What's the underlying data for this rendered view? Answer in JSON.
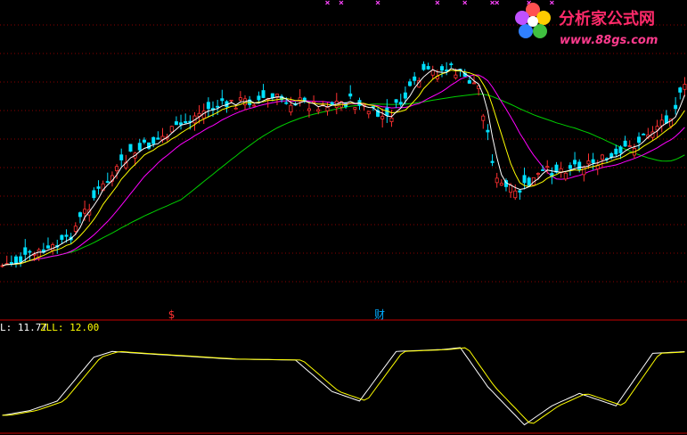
{
  "chart_data": [
    {
      "type": "candlestick",
      "title": "",
      "xlabel": "",
      "ylabel": "",
      "ylim": [
        0,
        100
      ],
      "grid": true,
      "bar_count": 150,
      "up_color": "#ff3030",
      "down_color": "#00e0ff",
      "marker_labels": [
        {
          "text": "$",
          "bar": 37,
          "color": "#ff3030"
        },
        {
          "text": "财",
          "bar": 82,
          "color": "#00aaff"
        }
      ],
      "ma_colors": {
        "fast": "#ffffff",
        "mid": "#ffff00",
        "slow": "#ff00ff",
        "long": "#00d000"
      }
    },
    {
      "type": "line",
      "title": "",
      "series": [
        {
          "name": "L",
          "label": ": 11.77",
          "color": "#ffffff"
        },
        {
          "name": "ZLL",
          "label": ": 12.00",
          "color": "#ffff00"
        }
      ],
      "ylim": [
        0,
        100
      ]
    }
  ],
  "watermark": {
    "brand": "分析家公式网",
    "url": "www.88gs.com"
  },
  "colors": {
    "background": "#000000",
    "grid": "#8b0000",
    "divider": "#c80000",
    "x_marker": "#ff44ff"
  }
}
